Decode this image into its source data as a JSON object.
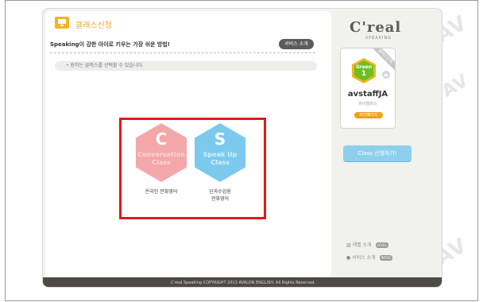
{
  "watermark": {
    "text": "AV"
  },
  "header": {
    "title": "클래스신청",
    "subtitle": "Speaking이 강한 아이로 키우는 가장 쉬운 방법!",
    "intro_button": "서비스 소개"
  },
  "notice": "• 원하는 클래스를 선택할 수 있습니다.",
  "classes": [
    {
      "letter": "C",
      "name_line1": "Conversation",
      "name_line2": "Class",
      "caption_line1": "온라인 전화영어",
      "caption_line2": "",
      "color": "#f4a7a9"
    },
    {
      "letter": "S",
      "name_line1": "Speak Up",
      "name_line2": "Class",
      "caption_line1": "단과수업용",
      "caption_line2": "전화영어",
      "color": "#7cc9ee"
    }
  ],
  "sidebar": {
    "logo": "C'real",
    "logo_sub": "SPEAKING",
    "level_ribbon": "클래스선택",
    "level_name": "Green",
    "level_number": "1",
    "username": "avstaffJA",
    "user_sub": "마이캠퍼스",
    "mypage_button": "마이페이지",
    "apply_button": "Class 신청하기!",
    "links": [
      {
        "label": "레벨 소개",
        "tag": "LEVEL"
      },
      {
        "label": "서비스 소개",
        "tag": "INTRO"
      }
    ]
  },
  "footer": "C'real Speaking COPYRIGHT 2013 AVALON ENGLISH. All Rights Reserved.",
  "highlight_color": "#e01b1b"
}
